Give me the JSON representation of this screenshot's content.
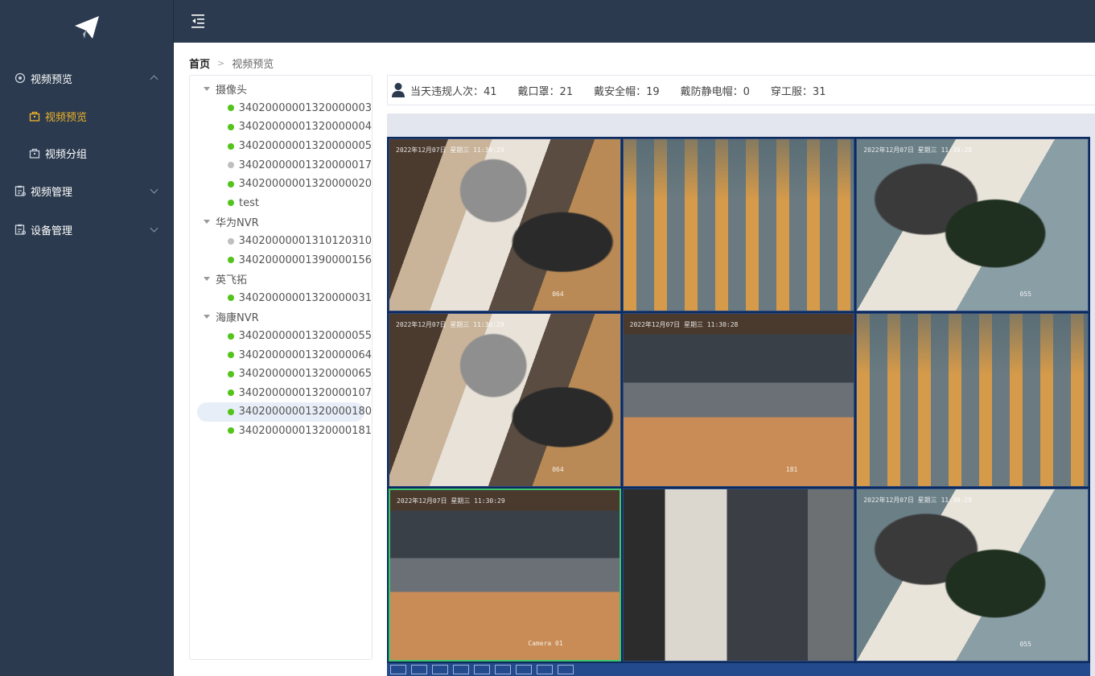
{
  "sidebar": {
    "menus": [
      {
        "label": "视频预览",
        "expanded": true,
        "icon": "gear-icon",
        "children": [
          {
            "label": "视频预览",
            "active": true,
            "icon": "bag-icon"
          },
          {
            "label": "视频分组",
            "active": false,
            "icon": "bag-icon"
          }
        ]
      },
      {
        "label": "视频管理",
        "expanded": false,
        "icon": "clipboard-icon"
      },
      {
        "label": "设备管理",
        "expanded": false,
        "icon": "clipboard-icon"
      }
    ]
  },
  "breadcrumb": {
    "home": "首页",
    "current": "视频预览"
  },
  "tree": {
    "groups": [
      {
        "label": "摄像头",
        "items": [
          {
            "label": "34020000001320000003",
            "online": true
          },
          {
            "label": "34020000001320000004",
            "online": true
          },
          {
            "label": "34020000001320000005",
            "online": true
          },
          {
            "label": "34020000001320000017",
            "online": false
          },
          {
            "label": "34020000001320000020",
            "online": true
          },
          {
            "label": "test",
            "online": true
          }
        ]
      },
      {
        "label": "华为NVR",
        "items": [
          {
            "label": "34020000001310120310",
            "online": false
          },
          {
            "label": "34020000001390000156",
            "online": true
          }
        ]
      },
      {
        "label": "英飞拓",
        "items": [
          {
            "label": "34020000001320000031",
            "online": true
          }
        ]
      },
      {
        "label": "海康NVR",
        "items": [
          {
            "label": "34020000001320000055",
            "online": true
          },
          {
            "label": "34020000001320000064",
            "online": true
          },
          {
            "label": "34020000001320000065",
            "online": true
          },
          {
            "label": "34020000001320000107",
            "online": true
          },
          {
            "label": "34020000001320000180",
            "online": true,
            "selected": true
          },
          {
            "label": "34020000001320000181",
            "online": true
          }
        ]
      }
    ]
  },
  "stats": {
    "violations": "当天违规人次：41",
    "mask": "戴口罩：21",
    "helmet": "戴安全帽：19",
    "antistatic": "戴防静电帽：0",
    "uniform": "穿工服：31"
  },
  "videos": [
    {
      "scene": "cables",
      "osd": "2022年12月07日 星期三 11:30:29",
      "cam": "064"
    },
    {
      "scene": "slats",
      "osd": "",
      "cam": ""
    },
    {
      "scene": "blur",
      "osd": "2022年12月07日 星期三 11:30:28",
      "cam": "055"
    },
    {
      "scene": "cables",
      "osd": "2022年12月07日 星期三 11:30:29",
      "cam": "064"
    },
    {
      "scene": "office",
      "osd": "2022年12月07日 星期三 11:30:28",
      "cam": "181"
    },
    {
      "scene": "slats",
      "osd": "",
      "cam": ""
    },
    {
      "scene": "office",
      "osd": "2022年12月07日 星期三 11:30:29",
      "cam": "Camera 01",
      "active": true
    },
    {
      "scene": "office2",
      "osd": "",
      "cam": ""
    },
    {
      "scene": "blur",
      "osd": "2022年12月07日 星期三 11:30:28",
      "cam": "055"
    }
  ],
  "colors": {
    "sidebar_bg": "#2b3a4e",
    "active": "#f0b429",
    "online": "#52c41a",
    "offline": "#bfbfbf",
    "grid_border": "#0d2a5c",
    "active_cell": "#3ec46d"
  }
}
